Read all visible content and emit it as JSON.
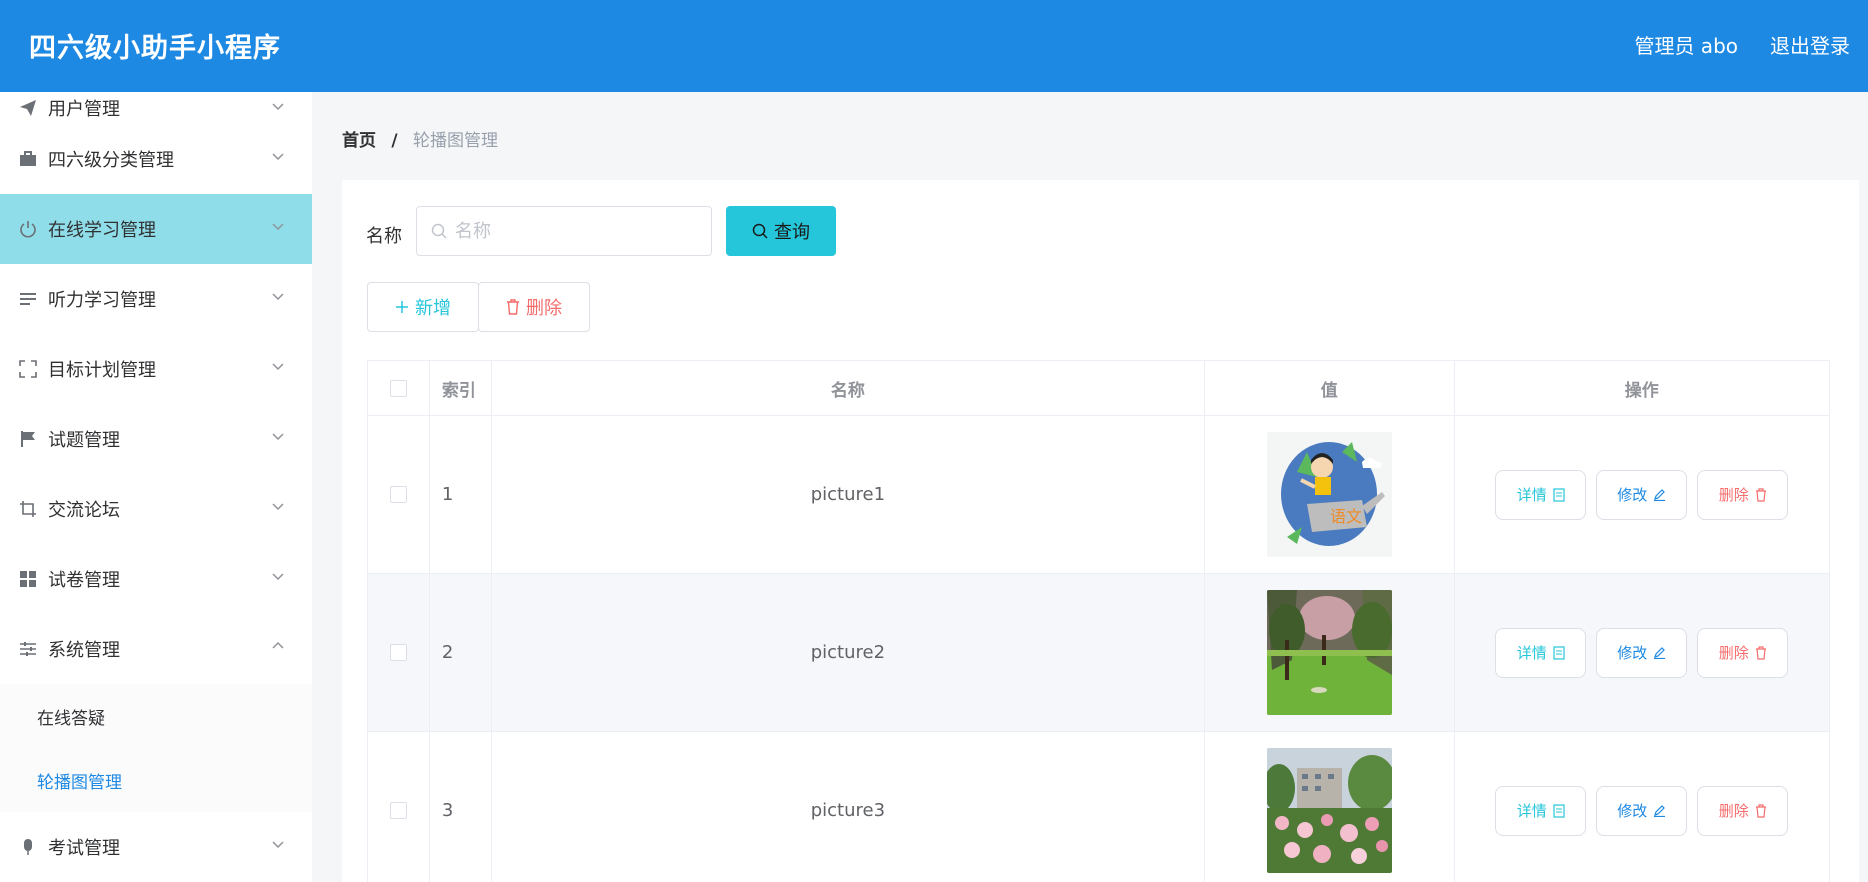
{
  "header": {
    "title": "四六级小助手小程序",
    "admin": "管理员 abo",
    "logout": "退出登录"
  },
  "sidebar": {
    "items": [
      {
        "label": "用户管理",
        "icon": "send-icon"
      },
      {
        "label": "四六级分类管理",
        "icon": "briefcase-icon"
      },
      {
        "label": "在线学习管理",
        "icon": "power-icon"
      },
      {
        "label": "听力学习管理",
        "icon": "list-icon"
      },
      {
        "label": "目标计划管理",
        "icon": "fullscreen-icon"
      },
      {
        "label": "试题管理",
        "icon": "flag-icon"
      },
      {
        "label": "交流论坛",
        "icon": "crop-icon"
      },
      {
        "label": "试卷管理",
        "icon": "grid-icon"
      },
      {
        "label": "系统管理",
        "icon": "sliders-icon"
      }
    ],
    "submenu": [
      "在线答疑",
      "轮播图管理"
    ],
    "last_item": {
      "label": "考试管理",
      "icon": "mic-icon"
    }
  },
  "breadcrumb": {
    "home": "首页",
    "separator": "/",
    "current": "轮播图管理"
  },
  "search": {
    "label": "名称",
    "placeholder": "名称",
    "button": "查询"
  },
  "actions": {
    "add": "新增",
    "delete": "删除"
  },
  "table": {
    "headers": {
      "index": "索引",
      "name": "名称",
      "value": "值",
      "operation": "操作"
    },
    "rows": [
      {
        "index": "1",
        "name": "picture1",
        "image": "cartoon-girl-watering-can"
      },
      {
        "index": "2",
        "name": "picture2",
        "image": "park-lawn-trees"
      },
      {
        "index": "3",
        "name": "picture3",
        "image": "peony-flowers-building"
      }
    ],
    "ops": {
      "detail": "详情",
      "edit": "修改",
      "delete": "删除"
    }
  },
  "colors": {
    "header": "#1e89e3",
    "accent": "#26c6da",
    "danger": "#f56c6c",
    "active_menu": "#8fdde8"
  }
}
